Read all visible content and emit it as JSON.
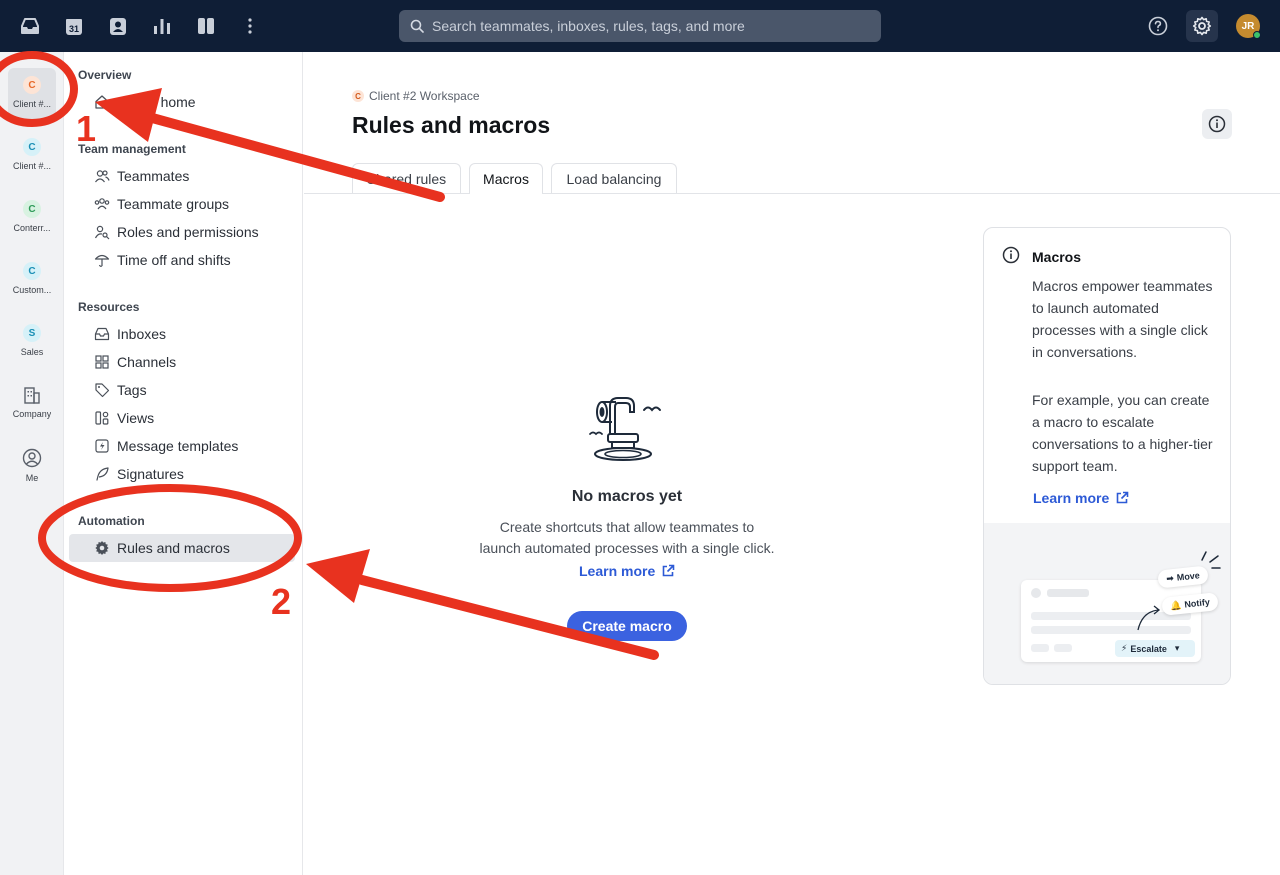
{
  "topbar": {
    "search_placeholder": "Search teammates, inboxes, rules, tags, and more",
    "calendar_day": "31",
    "avatar_initials": "JR",
    "icons": [
      "inbox-icon",
      "calendar-icon",
      "contacts-icon",
      "analytics-icon",
      "layout-icon",
      "more-icon",
      "search-icon",
      "help-icon",
      "gear-icon"
    ]
  },
  "rail": {
    "workspaces": [
      {
        "badge": "C",
        "label": "Client #...",
        "color": "#e8692a",
        "bg": "#fde4d6",
        "active": true
      },
      {
        "badge": "C",
        "label": "Client #...",
        "color": "#1a8fb5",
        "bg": "#d6f1f8"
      },
      {
        "badge": "C",
        "label": "Conterr...",
        "color": "#2e9a58",
        "bg": "#d8f2e1"
      },
      {
        "badge": "C",
        "label": "Custom...",
        "color": "#1a8fb5",
        "bg": "#d6f1f8"
      },
      {
        "badge": "S",
        "label": "Sales",
        "color": "#1a8fb5",
        "bg": "#d6f1f8"
      }
    ],
    "company_label": "Company",
    "me_label": "Me"
  },
  "sidebar": {
    "overview_title": "Overview",
    "admin_home": "Admin home",
    "team_title": "Team management",
    "team_items": [
      "Teammates",
      "Teammate groups",
      "Roles and permissions",
      "Time off and shifts"
    ],
    "resources_title": "Resources",
    "resource_items": [
      "Inboxes",
      "Channels",
      "Tags",
      "Views",
      "Message templates",
      "Signatures"
    ],
    "automation_title": "Automation",
    "automation_item": "Rules and macros"
  },
  "main": {
    "breadcrumb_badge": "C",
    "breadcrumb": "Client #2 Workspace",
    "title": "Rules and macros",
    "tabs": [
      "Shared rules",
      "Macros",
      "Load balancing"
    ],
    "active_tab": "Macros",
    "empty_title": "No macros yet",
    "empty_desc_1": "Create shortcuts that allow teammates to",
    "empty_desc_2": "launch automated processes with a single click.",
    "learn_more": "Learn more",
    "create_button": "Create macro"
  },
  "card": {
    "title": "Macros",
    "paragraph_1": "Macros empower teammates to launch automated processes with a single click in conversations.",
    "paragraph_2": "For example, you can create a macro to escalate conversations to a higher-tier support team.",
    "learn_more": "Learn more",
    "illo_move": "Move",
    "illo_notify": "Notify",
    "illo_escalate": "Escalate"
  },
  "annotations": {
    "label_1": "1",
    "label_2": "2",
    "color": "#e8321f"
  }
}
